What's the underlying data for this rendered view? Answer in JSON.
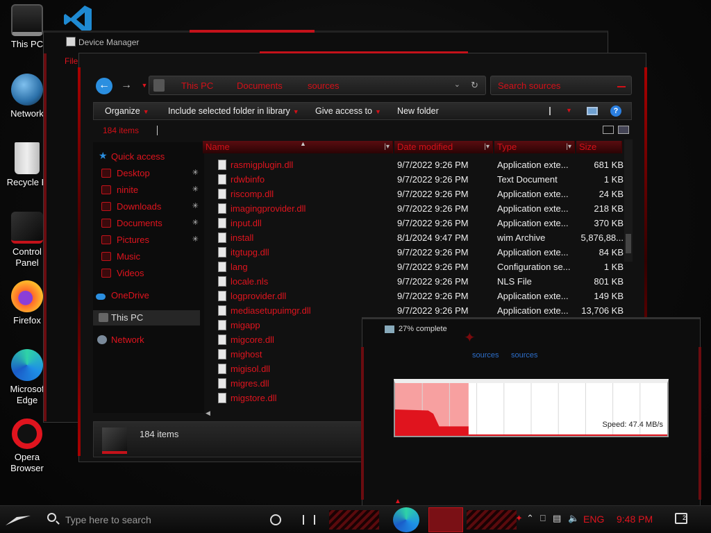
{
  "desktop": {
    "icons": [
      {
        "label": "This PC"
      },
      {
        "label": "Network"
      },
      {
        "label": "Recycle B"
      },
      {
        "label": "Control\nPanel"
      },
      {
        "label": "Firefox"
      },
      {
        "label": "Microsof\nEdge"
      },
      {
        "label": "Opera\nBrowser"
      }
    ]
  },
  "device_manager": {
    "title": "Device Manager",
    "menu_file": "File"
  },
  "explorer": {
    "breadcrumb": [
      "This PC",
      "Documents",
      "sources"
    ],
    "search_placeholder": "Search sources",
    "toolbar": {
      "organize": "Organize",
      "include": "Include selected folder in library",
      "share": "Give access to",
      "new_folder": "New folder"
    },
    "item_count": "184 items",
    "nav": {
      "quick_access": "Quick access",
      "items": [
        "Desktop",
        "ninite",
        "Downloads",
        "Documents",
        "Pictures",
        "Music",
        "Videos"
      ],
      "onedrive": "OneDrive",
      "this_pc": "This PC",
      "network": "Network"
    },
    "columns": {
      "name": "Name",
      "date": "Date modified",
      "type": "Type",
      "size": "Size"
    },
    "files": [
      {
        "name": "rasmigplugin.dll",
        "date": "9/7/2022 9:26 PM",
        "type": "Application exte...",
        "size": "681 KB"
      },
      {
        "name": "rdwbinfo",
        "date": "9/7/2022 9:26 PM",
        "type": "Text Document",
        "size": "1 KB"
      },
      {
        "name": "riscomp.dll",
        "date": "9/7/2022 9:26 PM",
        "type": "Application exte...",
        "size": "24 KB"
      },
      {
        "name": "imagingprovider.dll",
        "date": "9/7/2022 9:26 PM",
        "type": "Application exte...",
        "size": "218 KB"
      },
      {
        "name": "input.dll",
        "date": "9/7/2022 9:26 PM",
        "type": "Application exte...",
        "size": "370 KB"
      },
      {
        "name": "install",
        "date": "8/1/2024 9:47 PM",
        "type": "wim Archive",
        "size": "5,876,88..."
      },
      {
        "name": "itgtupg.dll",
        "date": "9/7/2022 9:26 PM",
        "type": "Application exte...",
        "size": "84 KB"
      },
      {
        "name": "lang",
        "date": "9/7/2022 9:26 PM",
        "type": "Configuration se...",
        "size": "1 KB"
      },
      {
        "name": "locale.nls",
        "date": "9/7/2022 9:26 PM",
        "type": "NLS File",
        "size": "801 KB"
      },
      {
        "name": "logprovider.dll",
        "date": "9/7/2022 9:26 PM",
        "type": "Application exte...",
        "size": "149 KB"
      },
      {
        "name": "mediasetupuimgr.dll",
        "date": "9/7/2022 9:26 PM",
        "type": "Application exte...",
        "size": "13,706 KB"
      },
      {
        "name": "migapp",
        "date": "",
        "type": "",
        "size": ""
      },
      {
        "name": "migcore.dll",
        "date": "",
        "type": "",
        "size": ""
      },
      {
        "name": "mighost",
        "date": "",
        "type": "",
        "size": ""
      },
      {
        "name": "migisol.dll",
        "date": "",
        "type": "",
        "size": ""
      },
      {
        "name": "migres.dll",
        "date": "",
        "type": "",
        "size": ""
      },
      {
        "name": "migstore.dll",
        "date": "",
        "type": "",
        "size": ""
      }
    ],
    "details_count": "184 items"
  },
  "copy_dialog": {
    "title": "27% complete",
    "progress_fraction": 0.27,
    "from": "sources",
    "to": "sources",
    "speed": "Speed: 47.4 MB/s"
  },
  "taskbar": {
    "search_placeholder": "Type here to search",
    "language": "ENG",
    "time": "9:48 PM",
    "notifications": "2"
  },
  "colors": {
    "accent": "#e0141e",
    "link": "#2d6ec9"
  }
}
